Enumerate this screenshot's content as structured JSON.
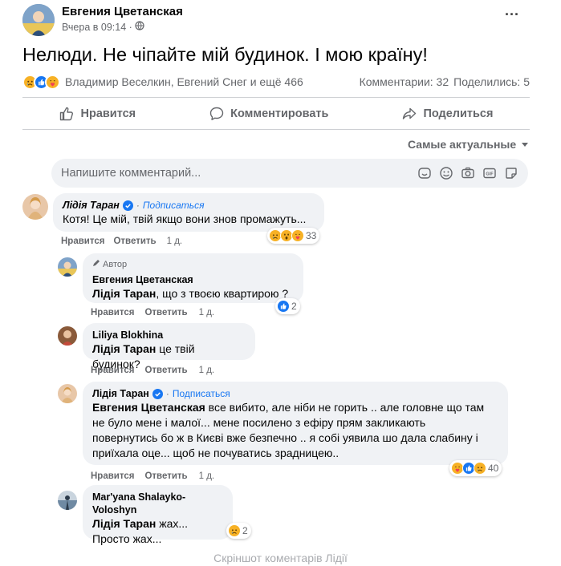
{
  "post": {
    "author": "Евгения Цветанская",
    "time": "Вчера в 09:14 ·",
    "text": "Нелюди. Не чіпайте мій будинок. І мою країну!",
    "more": "···",
    "reactors": "Владимир Веселкин, Евгений Снег и ещё 466",
    "comments_count": "Комментарии: 32",
    "shares_count": "Поделились: 5",
    "reaction_icons": [
      "sad-icon",
      "like-icon",
      "care-icon"
    ]
  },
  "actions": {
    "like": "Нравится",
    "comment": "Комментировать",
    "share": "Поделиться"
  },
  "sort": {
    "label": "Самые актуальные"
  },
  "comment_box": {
    "placeholder": "Напишите комментарий..."
  },
  "comments": [
    {
      "name": "Лідія Таран",
      "subscribe": "Подписаться",
      "text": "Котя! Це мій, твій якщо вони знов промажуть...",
      "like": "Нравится",
      "reply": "Ответить",
      "time": "1 д.",
      "reactions_count": "33",
      "reaction_icons": [
        "sad-icon",
        "wow-icon",
        "care-icon"
      ]
    },
    {
      "badge": "Автор",
      "name": "Евгения Цветанская",
      "mention": "Лідія Таран",
      "text": ", що з твоєю квартирою ?",
      "like": "Нравится",
      "reply": "Ответить",
      "time": "1 д.",
      "reactions_count": "2",
      "reaction_icons": [
        "like-icon"
      ]
    },
    {
      "name": "Liliya Blokhina",
      "mention": "Лідія Таран",
      "text": " це твій будинок?",
      "like": "Нравится",
      "reply": "Ответить",
      "time": "1 д."
    },
    {
      "name": "Лідія Таран",
      "subscribe": "Подписаться",
      "mention": "Евгения Цветанская",
      "text_lines": [
        " все вибито, але ніби не горить .. але головне що там",
        "не було мене і малої... мене посилено з ефіру прям закликають",
        "повернутись бо ж в Києві вже безпечно .. я собі уявила шо дала слабину і",
        "приїхала оце... щоб не почуватись зрадницею.."
      ],
      "like": "Нравится",
      "reply": "Ответить",
      "time": "1 д.",
      "reactions_count": "40",
      "reaction_icons": [
        "care-icon",
        "like-icon",
        "sad-icon"
      ]
    },
    {
      "name": "Mar'yana Shalayko-Voloshyn",
      "mention": "Лідія Таран",
      "text": " жах...",
      "text2": "Просто жах...",
      "reactions_count": "2",
      "reaction_icons": [
        "sad-icon"
      ]
    }
  ],
  "caption": "Скріншот коментарів Лідії",
  "colors": {
    "blue": "#1877f2",
    "bubble": "#f0f2f5",
    "muted": "#65676b"
  }
}
